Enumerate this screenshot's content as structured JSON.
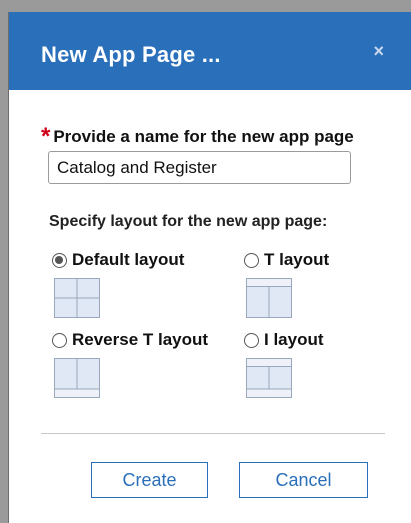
{
  "dialog": {
    "title": "New App Page ...",
    "close_glyph": "×",
    "required_mark": "*",
    "name_label": "Provide a name for the new app page",
    "name_value": "Catalog and Register",
    "layout_heading": "Specify layout for the new app page:",
    "layouts": [
      {
        "label": "Default layout",
        "selected": true,
        "icon": "default-layout-icon"
      },
      {
        "label": "T layout",
        "selected": false,
        "icon": "t-layout-icon"
      },
      {
        "label": "Reverse T layout",
        "selected": false,
        "icon": "reverse-t-layout-icon"
      },
      {
        "label": "I layout",
        "selected": false,
        "icon": "i-layout-icon"
      }
    ],
    "create_label": "Create",
    "cancel_label": "Cancel",
    "colors": {
      "titlebar": "#2a6fb9",
      "required": "#d0021b",
      "thumb_fill": "#dfe8f4",
      "thumb_stroke": "#9aa8bb"
    }
  }
}
